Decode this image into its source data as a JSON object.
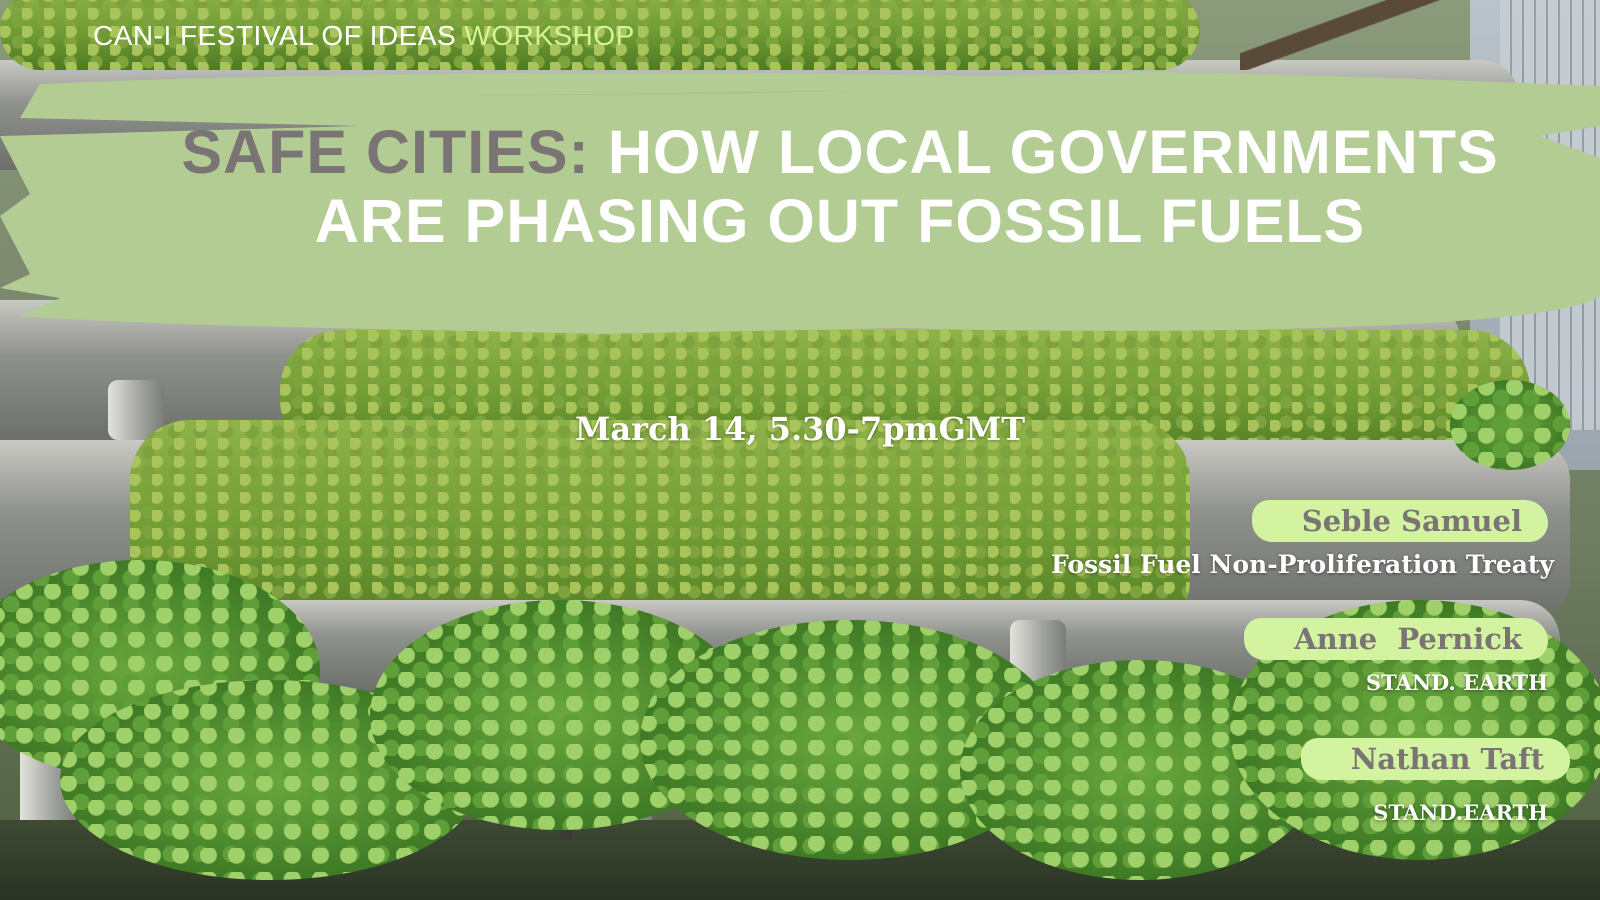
{
  "kicker": {
    "text": "CAN-I FESTIVAL OF IDEAS",
    "accent": "WORKSHOP"
  },
  "title": {
    "highlight": "SAFE CITIES:",
    "rest": "HOW LOCAL GOVERNMENTS ARE PHASING OUT FOSSIL FUELS"
  },
  "date": "March 14, 5.30-7pmGMT",
  "speakers": [
    {
      "name": "Seble Samuel",
      "org": "Fossil Fuel Non-Proliferation Treaty"
    },
    {
      "name": "Anne  Pernick",
      "org": "STAND. EARTH"
    },
    {
      "name": "Nathan Taft",
      "org": "STAND.EARTH"
    }
  ],
  "colors": {
    "band": "#b3cc94",
    "pill": "#d3f3a0",
    "accent_text": "#d4f29a",
    "grey_text": "#7a7574",
    "white_text": "#ffffff"
  },
  "icons": [
    "green-building-photo",
    "brush-stroke-banner"
  ]
}
